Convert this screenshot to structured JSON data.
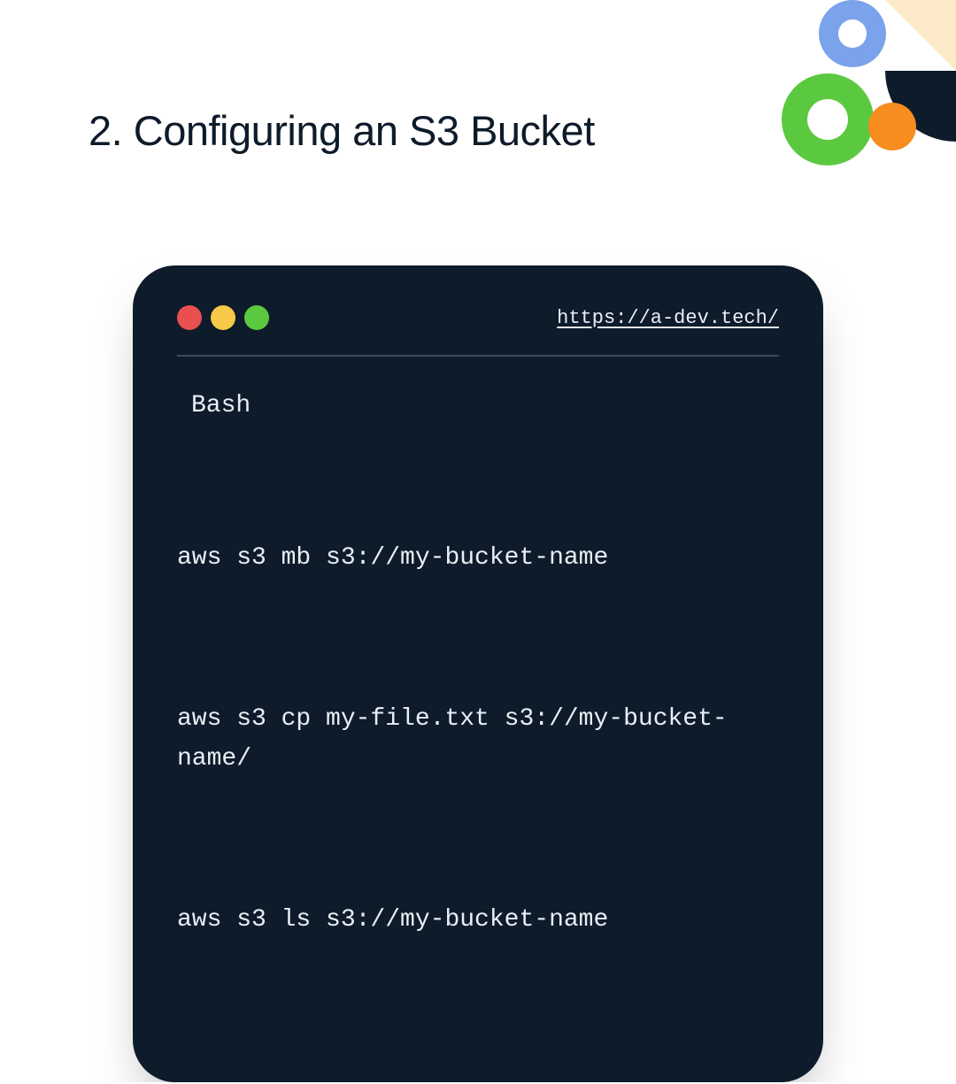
{
  "heading": "2. Configuring an S3 Bucket",
  "terminal": {
    "url": "https://a-dev.tech/",
    "language": "Bash",
    "commands": [
      "aws s3 mb s3://my-bucket-name",
      "aws s3 cp my-file.txt s3://my-bucket-name/",
      "aws s3 ls s3://my-bucket-name"
    ]
  },
  "colors": {
    "terminal_bg": "#0d1b2a",
    "dot_red": "#e94f4f",
    "dot_yellow": "#f7c948",
    "dot_green": "#5bc93f",
    "deco_blue": "#7ba3eb",
    "deco_green": "#5bc93f",
    "deco_orange": "#f78c1f",
    "deco_cream": "#fce9c7",
    "deco_dark": "#0d1b2a"
  }
}
